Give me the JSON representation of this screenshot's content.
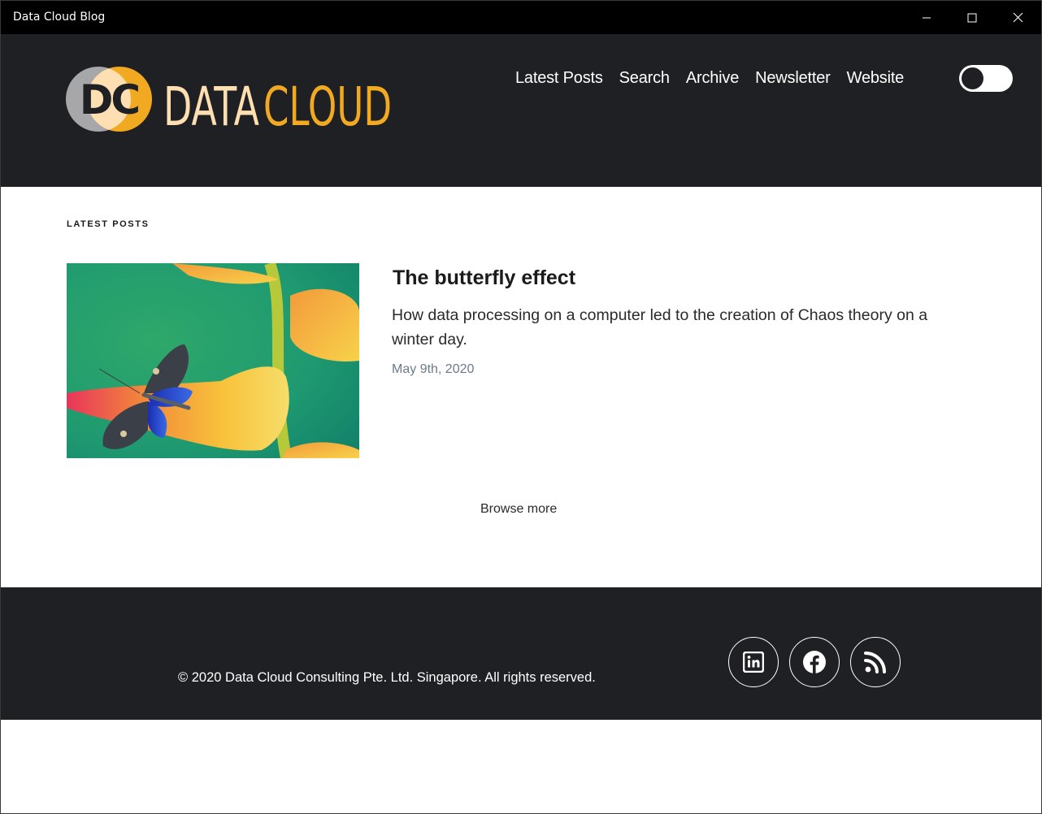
{
  "window": {
    "title": "Data Cloud Blog"
  },
  "header": {
    "logo": {
      "monogram": "DC",
      "word_data": "DATA",
      "word_cloud": "CLOUD"
    },
    "nav": [
      {
        "label": "Latest Posts"
      },
      {
        "label": "Search"
      },
      {
        "label": "Archive"
      },
      {
        "label": "Newsletter"
      },
      {
        "label": "Website"
      }
    ],
    "theme_toggle": {
      "state": "off",
      "icon": "toggle-icon"
    }
  },
  "main": {
    "section_label": "LATEST POSTS",
    "posts": [
      {
        "title": "The butterfly effect",
        "excerpt": "How data processing on a computer led to the creation of Chaos theory on a winter day.",
        "date": "May 9th, 2020"
      }
    ],
    "browse_more": "Browse more"
  },
  "footer": {
    "copyright": "© 2020 Data Cloud Consulting Pte. Ltd. Singapore. All rights reserved.",
    "social": [
      {
        "icon": "linkedin-icon"
      },
      {
        "icon": "facebook-icon"
      },
      {
        "icon": "rss-icon"
      }
    ]
  },
  "colors": {
    "header_bg": "#1f2023",
    "logo_gray": "#a7a6a8",
    "logo_orange": "#f2a922",
    "logo_cream": "#fddfb1",
    "date_text": "#6b7a8c"
  }
}
